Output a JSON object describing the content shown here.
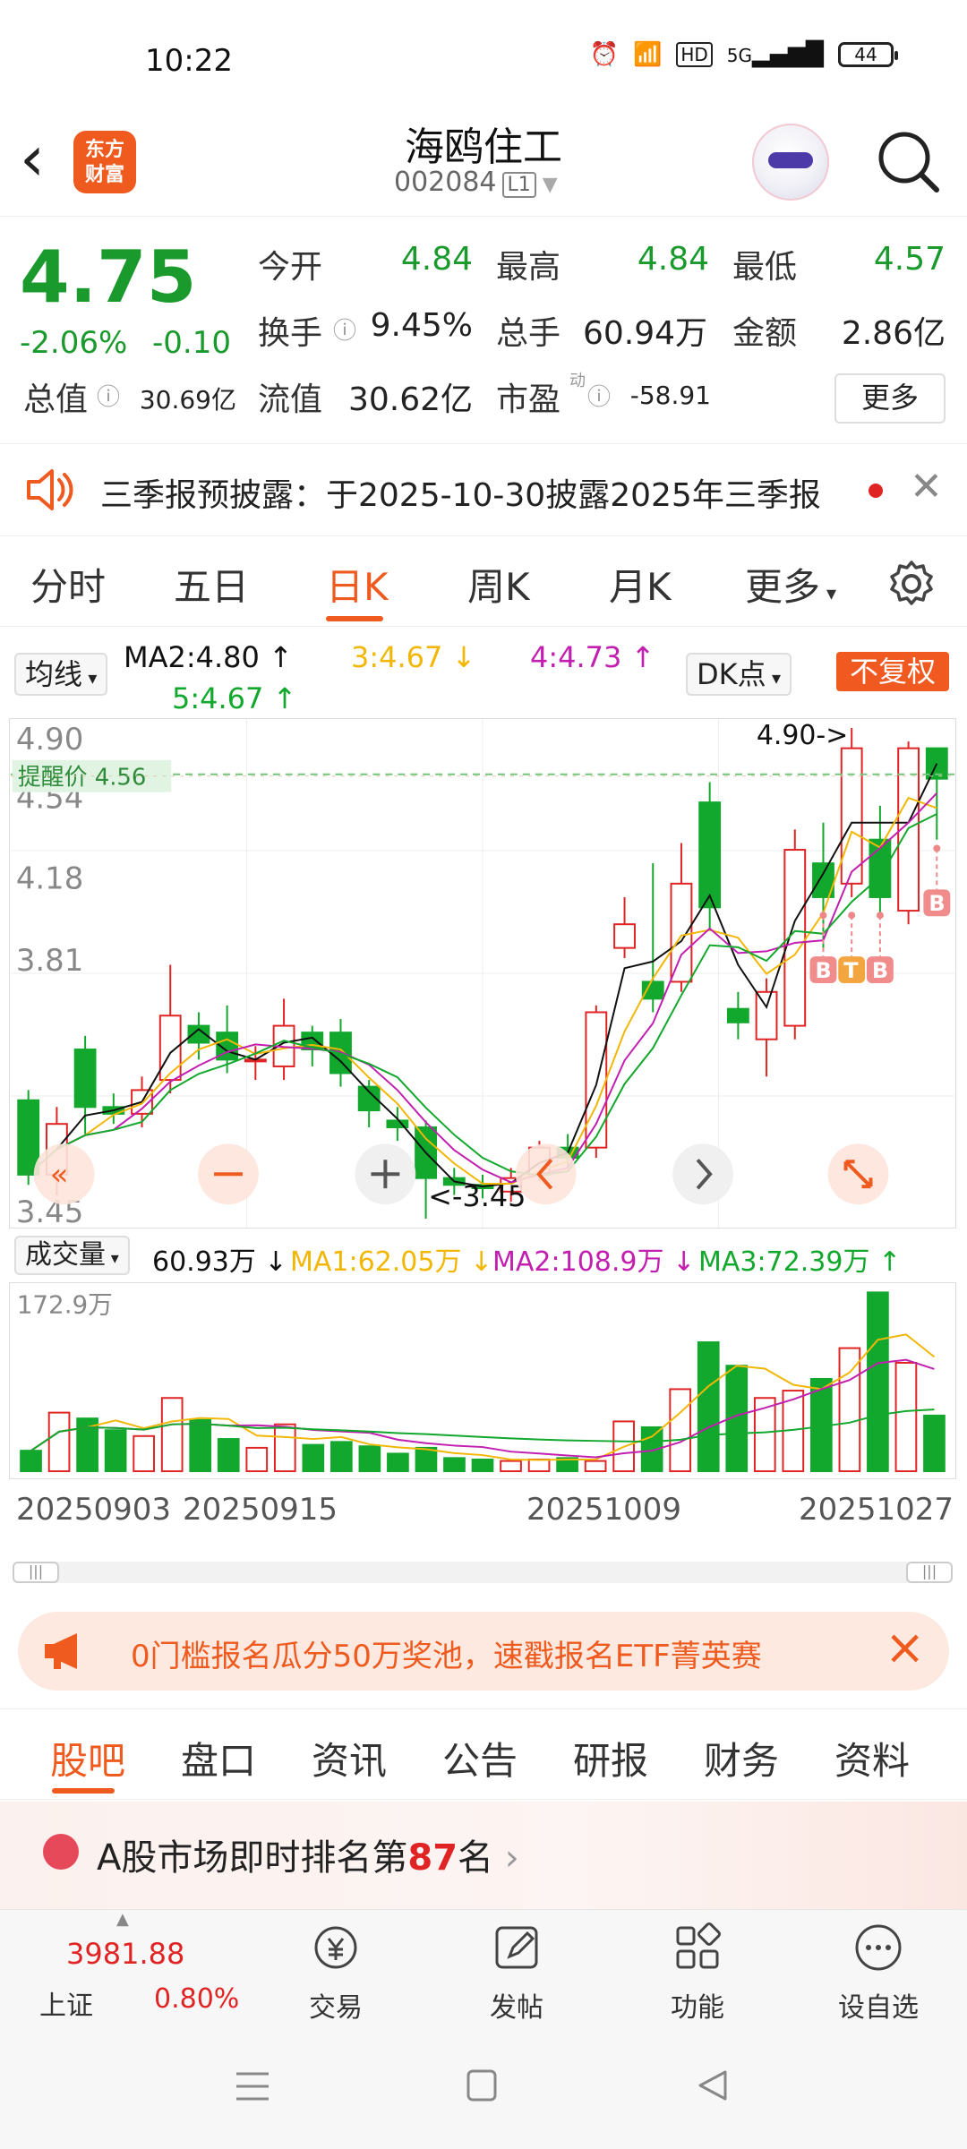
{
  "status_bar": {
    "time": "10:22",
    "network": "5G",
    "hd": "HD",
    "battery": "44"
  },
  "header": {
    "app_logo": "东方\n财富",
    "stock_name": "海鸥住工",
    "stock_code": "002084",
    "level": "L1"
  },
  "quote": {
    "price": "4.75",
    "change_pct": "-2.06%",
    "change": "-0.10",
    "open_label": "今开",
    "open": "4.84",
    "high_label": "最高",
    "high": "4.84",
    "low_label": "最低",
    "low": "4.57",
    "turnover_label": "换手",
    "turnover": "9.45%",
    "volume_label": "总手",
    "volume": "60.94万",
    "amount_label": "金额",
    "amount": "2.86亿",
    "total_cap_label": "总值",
    "total_cap": "30.69亿",
    "float_cap_label": "流值",
    "float_cap": "30.62亿",
    "pe_label": "市盈",
    "pe_tag": "动",
    "pe": "-58.91",
    "more_button": "更多"
  },
  "notice": {
    "text": "三季报预披露：于2025-10-30披露2025年三季报"
  },
  "chart_tabs": [
    "分时",
    "五日",
    "日K",
    "周K",
    "月K",
    "更多"
  ],
  "chart_tabs_active": 2,
  "ma_legend": {
    "selector": "均线",
    "ma2": "MA2:4.80",
    "ma3": "3:4.67",
    "ma4": "4:4.73",
    "ma5": "5:4.67",
    "dk_button": "DK点",
    "adjust_button": "不复权"
  },
  "chart_labels": {
    "y_top": "4.90",
    "y_mid": "4.54",
    "y_mid2": "4.18",
    "y_low": "3.81",
    "y_bottom": "3.45",
    "alert_price": "提醒价 4.56",
    "high_marker": "4.90->",
    "low_marker": "<-3.45",
    "volume_selector": "成交量",
    "volume_value": "60.93万",
    "vol_ma1": "MA1:62.05万",
    "vol_ma2": "MA2:108.9万",
    "vol_ma3": "MA3:72.39万",
    "vol_max": "172.9万",
    "dates": [
      "20250903",
      "20250915",
      "20251009",
      "20251027"
    ],
    "signals": [
      "B",
      "T",
      "B",
      "B"
    ]
  },
  "colors": {
    "up": "#e02424",
    "down": "#12a82d",
    "accent": "#ef5a1f",
    "ma_black": "#111111",
    "ma_yellow": "#f2b705",
    "ma_magenta": "#c21fb0",
    "ma_green": "#12a82d"
  },
  "promo": {
    "text": "0门槛报名瓜分50万奖池，速戳报名ETF菁英赛"
  },
  "section_tabs": [
    "股吧",
    "盘口",
    "资讯",
    "公告",
    "研报",
    "财务",
    "资料"
  ],
  "rank": {
    "prefix": "A股市场即时排名第",
    "number": "87",
    "suffix": "名"
  },
  "bottom_bar": {
    "index_value": "3981.88",
    "index_name": "上证",
    "index_change": "0.80%",
    "items": [
      "交易",
      "发帖",
      "功能",
      "设自选"
    ]
  },
  "chart_data": {
    "type": "candlestick",
    "ylim": [
      3.45,
      4.9
    ],
    "candles": [
      {
        "o": 3.8,
        "c": 3.58,
        "h": 3.83,
        "l": 3.55
      },
      {
        "o": 3.58,
        "c": 3.73,
        "h": 3.78,
        "l": 3.52
      },
      {
        "o": 3.95,
        "c": 3.78,
        "h": 3.99,
        "l": 3.7
      },
      {
        "o": 3.78,
        "c": 3.76,
        "h": 3.82,
        "l": 3.73
      },
      {
        "o": 3.76,
        "c": 3.83,
        "h": 3.87,
        "l": 3.72
      },
      {
        "o": 3.86,
        "c": 4.05,
        "h": 4.2,
        "l": 3.82
      },
      {
        "o": 4.02,
        "c": 3.97,
        "h": 4.06,
        "l": 3.92
      },
      {
        "o": 4.0,
        "c": 3.92,
        "h": 4.08,
        "l": 3.88
      },
      {
        "o": 3.92,
        "c": 3.92,
        "h": 3.96,
        "l": 3.86
      },
      {
        "o": 3.9,
        "c": 4.02,
        "h": 4.1,
        "l": 3.86
      },
      {
        "o": 4.0,
        "c": 3.95,
        "h": 4.02,
        "l": 3.9
      },
      {
        "o": 4.0,
        "c": 3.88,
        "h": 4.04,
        "l": 3.84
      },
      {
        "o": 3.84,
        "c": 3.77,
        "h": 3.86,
        "l": 3.72
      },
      {
        "o": 3.74,
        "c": 3.72,
        "h": 3.78,
        "l": 3.68
      },
      {
        "o": 3.72,
        "c": 3.57,
        "h": 3.74,
        "l": 3.45
      },
      {
        "o": 3.57,
        "c": 3.55,
        "h": 3.6,
        "l": 3.52
      },
      {
        "o": 3.55,
        "c": 3.54,
        "h": 3.58,
        "l": 3.51
      },
      {
        "o": 3.53,
        "c": 3.57,
        "h": 3.6,
        "l": 3.5
      },
      {
        "o": 3.58,
        "c": 3.66,
        "h": 3.68,
        "l": 3.56
      },
      {
        "o": 3.66,
        "c": 3.63,
        "h": 3.7,
        "l": 3.6
      },
      {
        "o": 3.66,
        "c": 4.06,
        "h": 4.08,
        "l": 3.63
      },
      {
        "o": 4.25,
        "c": 4.32,
        "h": 4.4,
        "l": 4.22
      },
      {
        "o": 4.15,
        "c": 4.1,
        "h": 4.5,
        "l": 4.06
      },
      {
        "o": 4.15,
        "c": 4.44,
        "h": 4.56,
        "l": 4.12
      },
      {
        "o": 4.68,
        "c": 4.37,
        "h": 4.74,
        "l": 4.3
      },
      {
        "o": 4.07,
        "c": 4.03,
        "h": 4.12,
        "l": 3.98
      },
      {
        "o": 3.98,
        "c": 4.12,
        "h": 4.16,
        "l": 3.87
      },
      {
        "o": 4.02,
        "c": 4.54,
        "h": 4.6,
        "l": 3.98
      },
      {
        "o": 4.5,
        "c": 4.4,
        "h": 4.62,
        "l": 4.25
      },
      {
        "o": 4.44,
        "c": 4.84,
        "h": 4.9,
        "l": 4.4
      },
      {
        "o": 4.57,
        "c": 4.4,
        "h": 4.67,
        "l": 4.35
      },
      {
        "o": 4.36,
        "c": 4.84,
        "h": 4.86,
        "l": 4.32
      },
      {
        "o": 4.84,
        "c": 4.75,
        "h": 4.84,
        "l": 4.57
      }
    ],
    "volume": [
      14,
      40,
      36,
      28,
      24,
      50,
      35,
      22,
      16,
      32,
      18,
      20,
      17,
      12,
      16,
      9,
      8,
      7,
      8,
      9,
      7,
      34,
      30,
      56,
      88,
      72,
      50,
      55,
      63,
      84,
      122,
      74,
      38
    ]
  }
}
